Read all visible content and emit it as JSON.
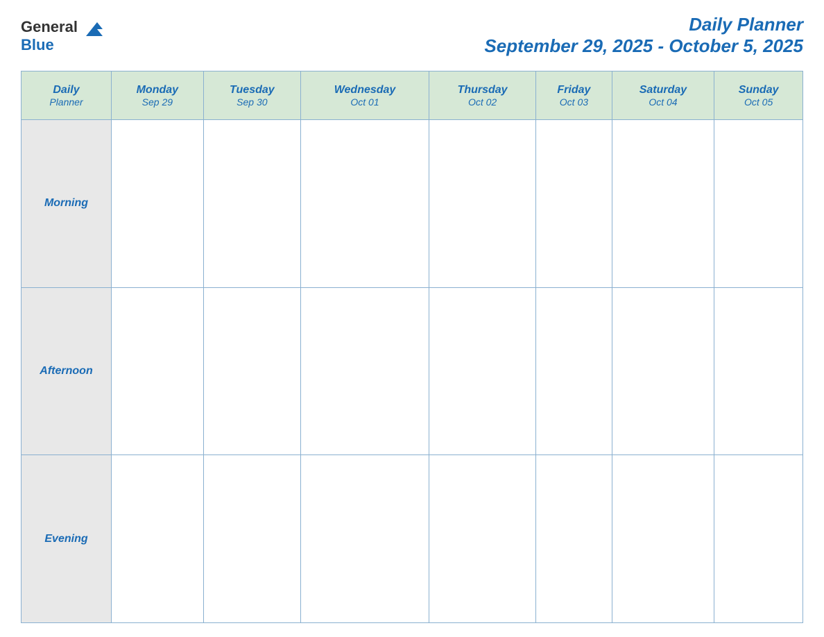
{
  "header": {
    "logo_line1": "General",
    "logo_line2": "Blue",
    "planner_title": "Daily Planner",
    "date_range": "September 29, 2025 - October 5, 2025"
  },
  "table": {
    "header_label_line1": "Daily",
    "header_label_line2": "Planner",
    "days": [
      {
        "name": "Monday",
        "date": "Sep 29"
      },
      {
        "name": "Tuesday",
        "date": "Sep 30"
      },
      {
        "name": "Wednesday",
        "date": "Oct 01"
      },
      {
        "name": "Thursday",
        "date": "Oct 02"
      },
      {
        "name": "Friday",
        "date": "Oct 03"
      },
      {
        "name": "Saturday",
        "date": "Oct 04"
      },
      {
        "name": "Sunday",
        "date": "Oct 05"
      }
    ],
    "rows": [
      {
        "label": "Morning"
      },
      {
        "label": "Afternoon"
      },
      {
        "label": "Evening"
      }
    ]
  }
}
